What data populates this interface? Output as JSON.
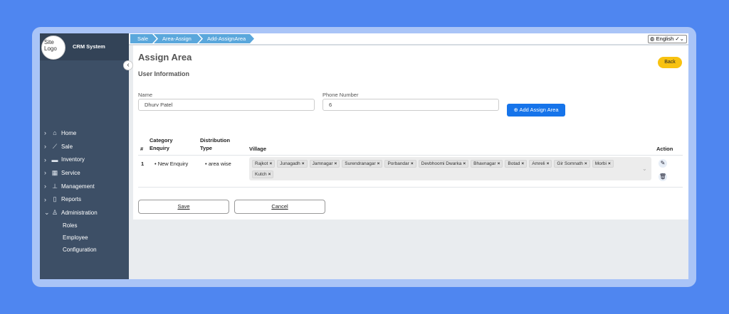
{
  "brand": {
    "logo_alt": "Site Logo",
    "name": "CRM System"
  },
  "breadcrumb": [
    "Sale",
    "Area-Assign",
    "Add-AssignArea"
  ],
  "language": "English",
  "sidebar": {
    "items": [
      {
        "label": "Home",
        "icon": "home-icon"
      },
      {
        "label": "Sale",
        "icon": "chart-line-icon"
      },
      {
        "label": "Inventory",
        "icon": "truck-icon"
      },
      {
        "label": "Service",
        "icon": "grid-icon"
      },
      {
        "label": "Management",
        "icon": "sitemap-icon"
      },
      {
        "label": "Reports",
        "icon": "document-icon"
      },
      {
        "label": "Administration",
        "icon": "user-gear-icon"
      }
    ],
    "sub_items": [
      "Roles",
      "Employee",
      "Configuration"
    ]
  },
  "page": {
    "title": "Assign Area",
    "section": "User Information",
    "back_label": "Back"
  },
  "form": {
    "name_label": "Name",
    "name_value": "Dhurv Patel",
    "phone_label": "Phone Number",
    "phone_value": "6",
    "add_button": "Add Assign Area"
  },
  "table": {
    "headers": {
      "num": "#",
      "category": "Category Enquiry",
      "distribution": "Distribution Type",
      "village": "Village",
      "action": "Action"
    },
    "row": {
      "num": "1",
      "category": "New Enquiry",
      "distribution": "area wise",
      "villages": [
        "Rajkot",
        "Junagadh",
        "Jamnagar",
        "Surendranagar",
        "Porbandar",
        "Devbhoomi Dwarka",
        "Bhavnagar",
        "Botad",
        "Amreli",
        "Gir Somnath",
        "Morbi",
        "Kutch"
      ]
    }
  },
  "buttons": {
    "save": "Save",
    "cancel": "Cancel"
  },
  "colors": {
    "sidebar": "#3d4f66",
    "primary": "#1674ea",
    "back": "#f8c210",
    "breadcrumb": "#5aa7dc"
  }
}
